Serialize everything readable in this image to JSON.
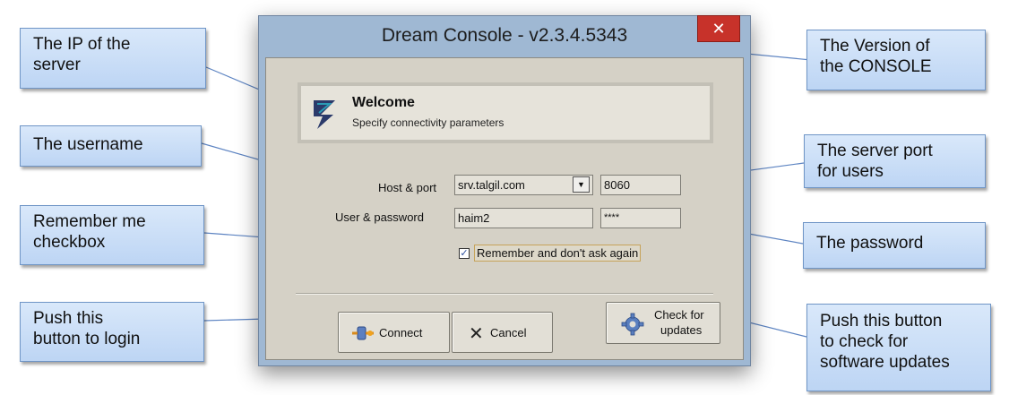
{
  "window": {
    "title": "Dream Console - v2.3.4.5343",
    "close_glyph": "✕"
  },
  "welcome": {
    "title": "Welcome",
    "subtitle": "Specify connectivity parameters",
    "logo": "dream-logo-icon"
  },
  "form": {
    "host_port_label": "Host & port",
    "host_value": "srv.talgil.com",
    "port_value": "8060",
    "user_password_label": "User & password",
    "user_value": "haim2",
    "password_value": "****",
    "remember_label": "Remember and don't ask again",
    "remember_checked": true
  },
  "buttons": {
    "connect": "Connect",
    "cancel": "Cancel",
    "check_updates_line1": "Check for",
    "check_updates_line2": "updates"
  },
  "callouts": {
    "ip": [
      "The IP of the",
      "server"
    ],
    "username": [
      "The username"
    ],
    "remember": [
      "Remember me",
      "checkbox"
    ],
    "login": [
      "Push this",
      "button to login"
    ],
    "version": [
      "The Version of",
      "the CONSOLE"
    ],
    "port": [
      "The server port",
      "for users"
    ],
    "password": [
      "The password"
    ],
    "updates": [
      "Push this button",
      "to check for",
      "software updates"
    ]
  },
  "colors": {
    "callout_fill": "#c8dcf6",
    "callout_border": "#6f95c6",
    "close": "#c7322a",
    "window_frame": "#9fb8d3"
  }
}
